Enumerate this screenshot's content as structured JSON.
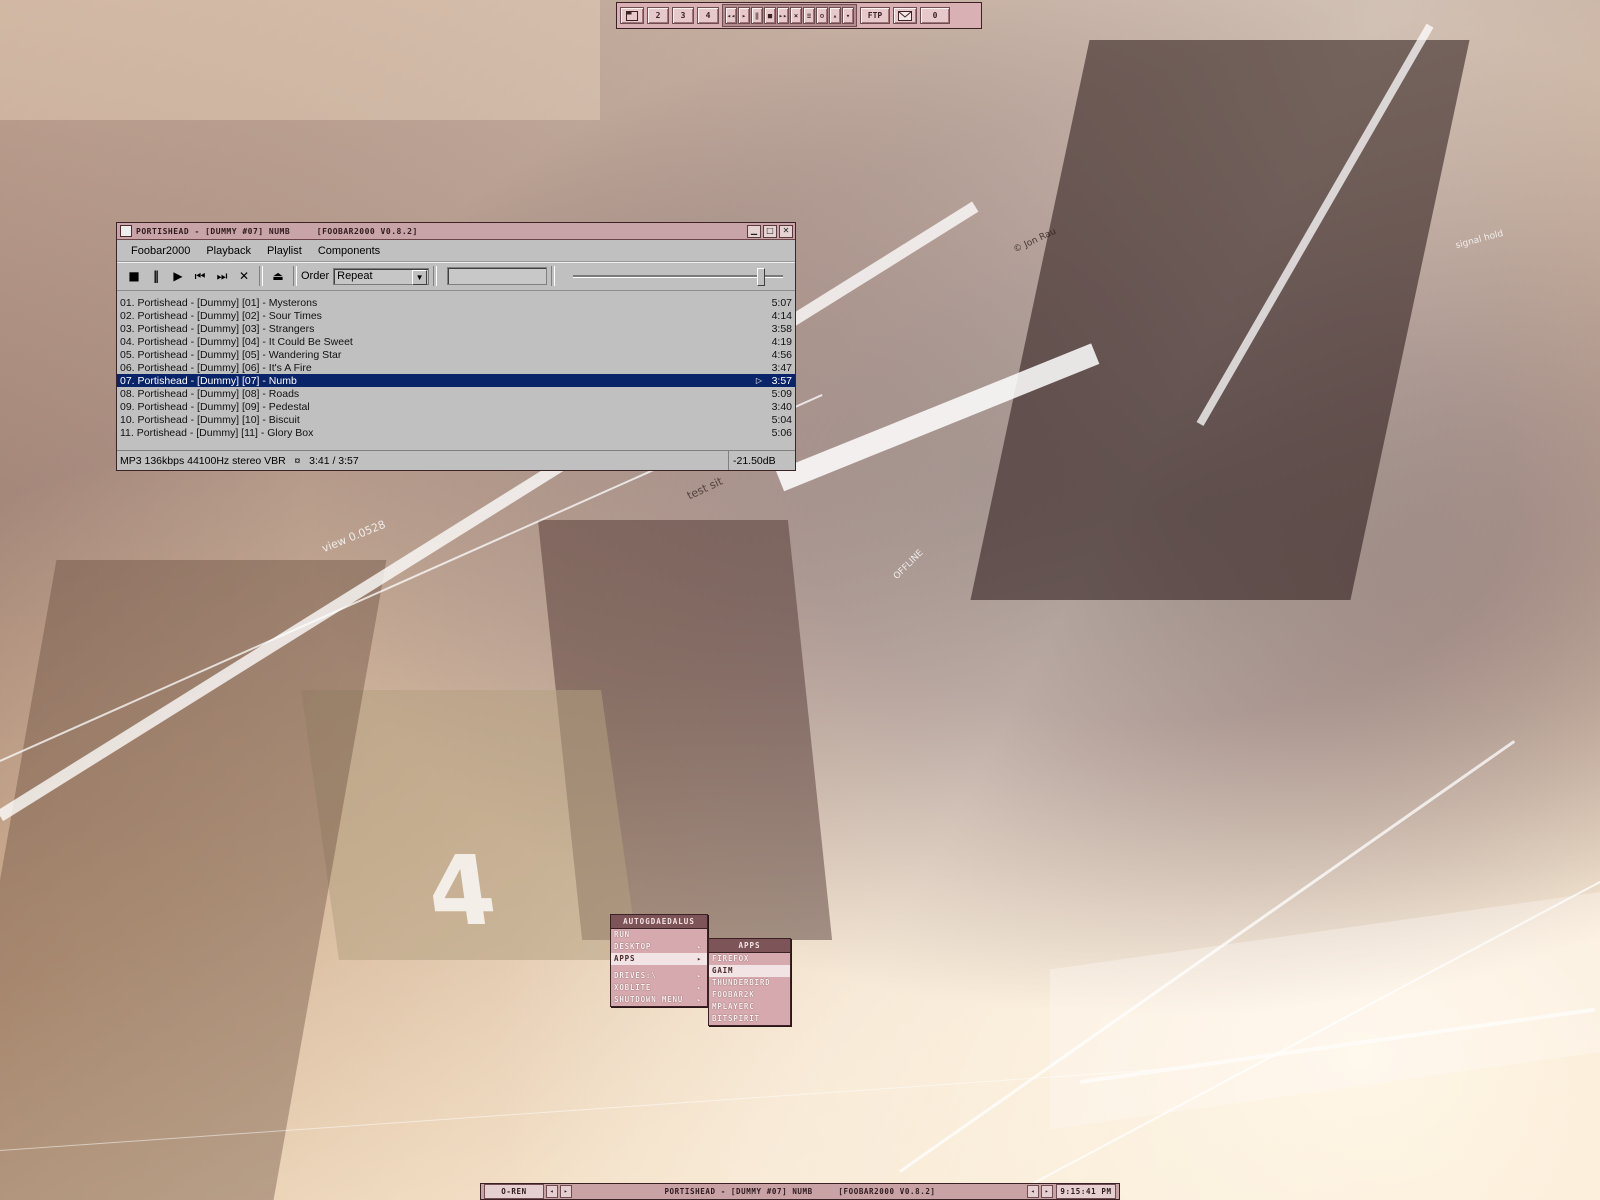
{
  "top_taskbar": {
    "desktops": [
      "2",
      "3",
      "4"
    ],
    "ftp_label": "FTP",
    "mail_count": "0"
  },
  "foobar": {
    "title": "PORTISHEAD - [DUMMY #07] NUMB     [FOOBAR2000 V0.8.2]",
    "menu": [
      "Foobar2000",
      "Playback",
      "Playlist",
      "Components"
    ],
    "order_label": "Order",
    "order_value": "Repeat",
    "volume_level": 0.92,
    "playlist": [
      {
        "title": "01. Portishead - [Dummy] [01] - Mysterons",
        "duration": "5:07"
      },
      {
        "title": "02. Portishead - [Dummy] [02] - Sour Times",
        "duration": "4:14"
      },
      {
        "title": "03. Portishead - [Dummy] [03] - Strangers",
        "duration": "3:58"
      },
      {
        "title": "04. Portishead - [Dummy] [04] - It Could Be Sweet",
        "duration": "4:19"
      },
      {
        "title": "05. Portishead - [Dummy] [05] - Wandering Star",
        "duration": "4:56"
      },
      {
        "title": "06. Portishead - [Dummy] [06] - It's A Fire",
        "duration": "3:47"
      },
      {
        "title": "07. Portishead - [Dummy] [07] - Numb",
        "duration": "3:57"
      },
      {
        "title": "08. Portishead - [Dummy] [08] - Roads",
        "duration": "5:09"
      },
      {
        "title": "09. Portishead - [Dummy] [09] - Pedestal",
        "duration": "3:40"
      },
      {
        "title": "10. Portishead - [Dummy] [10] - Biscuit",
        "duration": "5:04"
      },
      {
        "title": "11. Portishead - [Dummy] [11] - Glory Box",
        "duration": "5:06"
      }
    ],
    "selected_index": 6,
    "status": "MP3 136kbps 44100Hz stereo VBR   ¤   3:41 / 3:57",
    "gain": "-21.50dB"
  },
  "start_menu": {
    "header": "AUTOGDAEDALUS",
    "items": [
      "RUN",
      "DESKTOP",
      "APPS",
      "DRIVES:\\",
      "XOBLITE",
      "SHUTDOWN MENU"
    ]
  },
  "apps_menu": {
    "header": "APPS",
    "items": [
      "FIREFOX",
      "GAIM",
      "THUNDERBIRD",
      "FOOBAR2K",
      "MPLAYERC",
      "BITSPIRIT"
    ]
  },
  "bottom_taskbar": {
    "workspace": "O-REN",
    "task": "PORTISHEAD - [DUMMY #07] NUMB     [FOOBAR2000 V0.8.2]",
    "clock": "9:15:41 PM"
  },
  "wallpaper": {
    "texts": [
      "view 0.0528",
      "OFFLINE",
      "signal hold",
      "test sit",
      "© Jon Rau",
      "4"
    ]
  }
}
